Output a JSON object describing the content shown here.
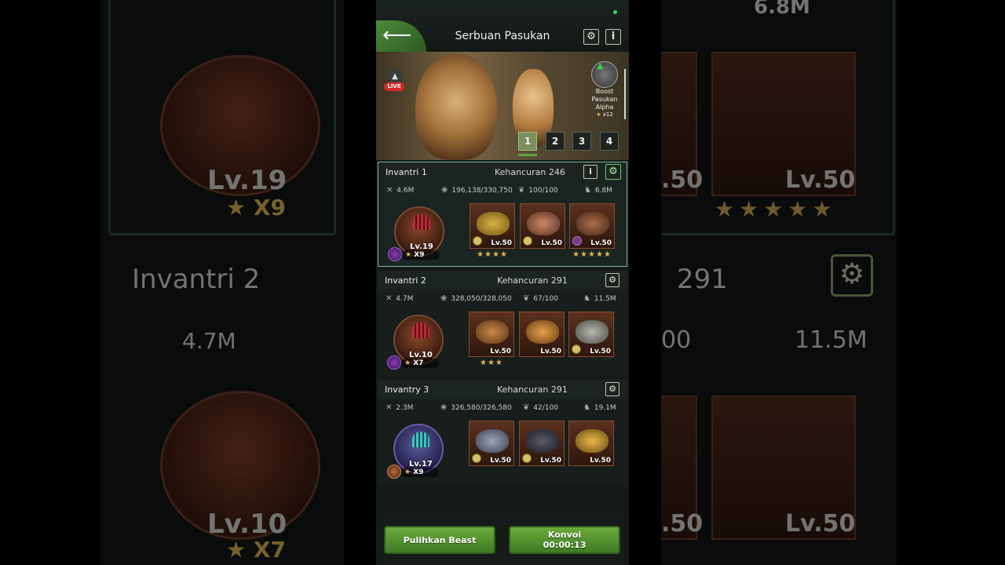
{
  "header": {
    "title": "Serbuan Pasukan",
    "back_icon": "arrow-left-icon",
    "settings_icon": "gear-icon",
    "info_label": "i"
  },
  "banner": {
    "live_label": "LIVE",
    "boost": {
      "line1": "Boost",
      "line2": "Pasukan",
      "line3": "Alpha",
      "multiplier": "x12"
    },
    "pages": [
      "1",
      "2",
      "3",
      "4"
    ],
    "active_page": "1"
  },
  "squads": [
    {
      "name": "Invantri 1",
      "destruction": "Kehancuran 246",
      "attack": "4.6M",
      "hp": "196,138/330,750",
      "morale": "100/100",
      "power": "6.8M",
      "hero": {
        "level": "Lv.19",
        "multiplier": "X9"
      },
      "beasts": [
        {
          "level": "Lv.50",
          "stars": "★★★★"
        },
        {
          "level": "Lv.50",
          "stars": ""
        },
        {
          "level": "Lv.50",
          "stars": "★★★★★"
        }
      ]
    },
    {
      "name": "Invantri 2",
      "destruction": "Kehancuran 291",
      "attack": "4.7M",
      "hp": "328,050/328,050",
      "morale": "67/100",
      "power": "11.5M",
      "hero": {
        "level": "Lv.10",
        "multiplier": "X7"
      },
      "beasts": [
        {
          "level": "Lv.50",
          "stars": "★★★"
        },
        {
          "level": "Lv.50",
          "stars": ""
        },
        {
          "level": "Lv.50",
          "stars": ""
        }
      ]
    },
    {
      "name": "Invantry 3",
      "destruction": "Kehancuran 291",
      "attack": "2.3M",
      "hp": "326,580/326,580",
      "morale": "42/100",
      "power": "19.1M",
      "hero": {
        "level": "Lv.17",
        "multiplier": "X9"
      },
      "beasts": [
        {
          "level": "Lv.50",
          "stars": ""
        },
        {
          "level": "Lv.50",
          "stars": ""
        },
        {
          "level": "Lv.50",
          "stars": ""
        }
      ]
    }
  ],
  "footer": {
    "restore_button": "Pulihkan Beast",
    "convoy_label": "Konvoi",
    "convoy_timer": "00:00:13"
  },
  "backdrop": {
    "left_level_1": "Lv.19",
    "left_mult_1": "X9",
    "left_squad": "Invantri 2",
    "left_attack": "4.7M",
    "left_level_2": "Lv.10",
    "left_mult_2": "X7",
    "right_level_1": "Lv.50",
    "right_level_1b": ".50",
    "right_power": "11.5M",
    "right_destr": "291",
    "right_morale": "00",
    "right_level_2": "Lv.50",
    "right_level_2b": ".50",
    "right_top": "6.8M"
  },
  "colors": {
    "accent_green": "#5fa544",
    "selected_border": "#7db99a",
    "star_gold": "#e3b54f",
    "live_red": "#d62a2a"
  }
}
